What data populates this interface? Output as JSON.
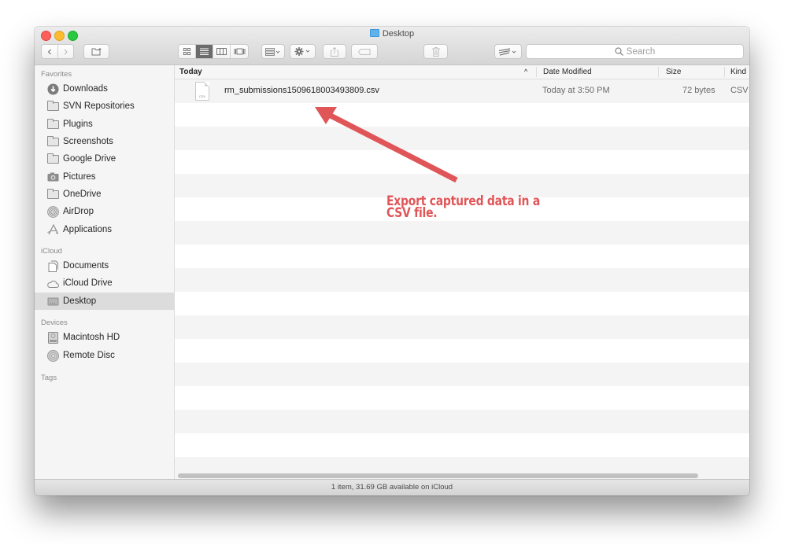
{
  "window": {
    "title": "Desktop",
    "title_icon": "folder-icon"
  },
  "toolbar": {
    "back": "‹",
    "forward": "›",
    "new_folder_icon": "new-folder-icon",
    "view_modes": [
      {
        "name": "icon-view",
        "glyph": "▫▫",
        "active": false
      },
      {
        "name": "list-view",
        "glyph": "≡",
        "active": true
      },
      {
        "name": "column-view",
        "glyph": "▥",
        "active": false
      },
      {
        "name": "cover-flow-view",
        "glyph": "|▭|",
        "active": false
      }
    ],
    "arrange_glyph": "▦ ˅",
    "action_glyph": "✱ ˅",
    "share_glyph": "⇧",
    "tag_glyph": "⬭",
    "delete_glyph": "🗑",
    "svn_glyph": "≶ ˅",
    "search_placeholder": "Search",
    "search_glyph": "⚲"
  },
  "sidebar": {
    "sections": [
      {
        "header": "Favorites",
        "items": [
          {
            "label": "Downloads",
            "icon": "downloads-icon"
          },
          {
            "label": "SVN Repositories",
            "icon": "folder-icon"
          },
          {
            "label": "Plugins",
            "icon": "folder-icon"
          },
          {
            "label": "Screenshots",
            "icon": "folder-icon"
          },
          {
            "label": "Google Drive",
            "icon": "folder-icon"
          },
          {
            "label": "Pictures",
            "icon": "camera-icon"
          },
          {
            "label": "OneDrive",
            "icon": "folder-icon"
          },
          {
            "label": "AirDrop",
            "icon": "airdrop-icon"
          },
          {
            "label": "Applications",
            "icon": "applications-icon"
          }
        ]
      },
      {
        "header": "iCloud",
        "items": [
          {
            "label": "Documents",
            "icon": "documents-icon"
          },
          {
            "label": "iCloud Drive",
            "icon": "cloud-icon"
          },
          {
            "label": "Desktop",
            "icon": "desktop-icon",
            "selected": true
          }
        ]
      },
      {
        "header": "Devices",
        "items": [
          {
            "label": "Macintosh HD",
            "icon": "hard-drive-icon"
          },
          {
            "label": "Remote Disc",
            "icon": "disc-icon"
          }
        ]
      },
      {
        "header": "Tags",
        "items": []
      }
    ]
  },
  "file_list": {
    "columns": {
      "name": "Today",
      "sort_indicator": "^",
      "date": "Date Modified",
      "size": "Size",
      "kind": "Kind"
    },
    "rows": [
      {
        "name": "rm_submissions1509618003493809.csv",
        "date": "Today at 3:50 PM",
        "size": "72 bytes",
        "kind": "CSV",
        "icon_label": "CSV"
      }
    ]
  },
  "status_bar": {
    "text": "1 item, 31.69 GB available on iCloud"
  },
  "annotation": {
    "line1": "Export captured data in a",
    "line2": "CSV file.",
    "color": "#e05558"
  }
}
